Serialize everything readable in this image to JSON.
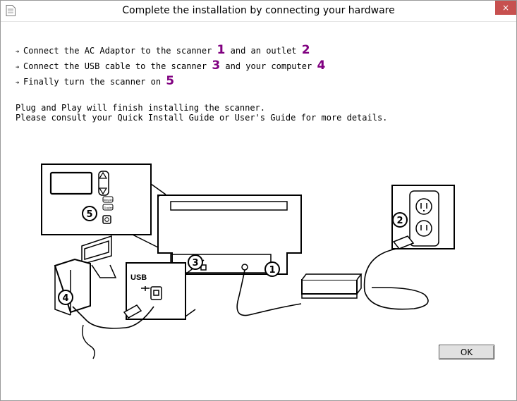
{
  "window": {
    "title": "Complete the installation by connecting your hardware",
    "close_label": "×"
  },
  "steps": [
    {
      "segments": [
        "Connect the AC Adaptor to the scanner ",
        "1",
        " and an outlet ",
        "2"
      ]
    },
    {
      "segments": [
        "Connect the USB cable to the scanner ",
        "3",
        " and your computer ",
        "4"
      ]
    },
    {
      "segments": [
        "Finally turn the scanner on ",
        "5"
      ]
    }
  ],
  "info": {
    "line1": "Plug and Play will finish installing the scanner.",
    "line2": "Please consult your Quick Install Guide or User's Guide for more details."
  },
  "illustration": {
    "callouts": [
      "5",
      "3",
      "1",
      "2",
      "4"
    ],
    "usb_title": "USB",
    "panel_buttons": [
      "Simplex",
      "Duplex"
    ]
  },
  "buttons": {
    "ok_label": "OK"
  },
  "colors": {
    "step_number": "#800080",
    "close_bg": "#c7504f"
  }
}
